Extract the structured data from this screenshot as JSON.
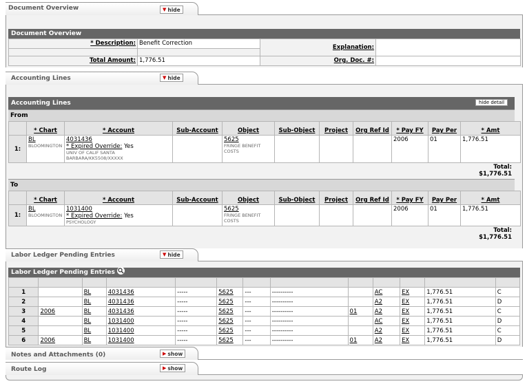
{
  "tabs": {
    "document_overview": {
      "title": "Document Overview",
      "button": "hide"
    },
    "accounting_lines": {
      "title": "Accounting Lines",
      "button": "hide"
    },
    "labor_ledger": {
      "title": "Labor Ledger Pending Entries",
      "button": "hide"
    },
    "notes": {
      "title": "Notes and Attachments (0)",
      "button": "show"
    },
    "route_log": {
      "title": "Route Log",
      "button": "show"
    }
  },
  "document_overview": {
    "header": "Document Overview",
    "description_label": "* Description:",
    "description_value": "Benefit Correction",
    "explanation_label": "Explanation:",
    "explanation_value": "",
    "total_amount_label": "Total Amount:",
    "total_amount_value": "1,776.51",
    "org_doc_label": "Org. Doc. #:",
    "org_doc_value": ""
  },
  "accounting": {
    "header": "Accounting Lines",
    "hide_detail": "hide detail",
    "columns": [
      "* Chart",
      "* Account",
      "Sub-Account",
      "Object",
      "Sub-Object",
      "Project",
      "Org Ref Id",
      "* Pay FY",
      "Pay Per",
      "* Amt"
    ],
    "from": {
      "label": "From",
      "row_num": "1:",
      "chart": "BL",
      "chart_desc": "BLOOMINGTON",
      "account": "4031436",
      "expired": "* Expired Override:",
      "expired_value": "Yes",
      "account_desc": "UNIV OF CALIF SANTA BARBARA/KK5508/XXXXX",
      "object": "5625",
      "object_desc": "FRINGE BENEFIT COSTS",
      "pay_fy": "2006",
      "pay_per": "01",
      "amt": "1,776.51",
      "total_label": "Total:",
      "total_value": "$1,776.51"
    },
    "to": {
      "label": "To",
      "row_num": "1:",
      "chart": "BL",
      "chart_desc": "BLOOMINGTON",
      "account": "1031400",
      "expired": "* Expired Override:",
      "expired_value": "Yes",
      "account_desc": "PSYCHOLOGY",
      "object": "5625",
      "object_desc": "FRINGE BENEFIT COSTS",
      "pay_fy": "2006",
      "pay_per": "01",
      "amt": "1,776.51",
      "total_label": "Total:",
      "total_value": "$1,776.51"
    }
  },
  "labor": {
    "header": "Labor Ledger Pending Entries",
    "rows": [
      {
        "n": "1",
        "fy": "",
        "chart": "BL",
        "acct": "4031436",
        "sub": "-----",
        "obj": "5625",
        "subobj": "---",
        "proj": "----------",
        "ref": "",
        "bal": "AC",
        "type": "EX",
        "amt": "1,776.51",
        "dc": "C"
      },
      {
        "n": "2",
        "fy": "",
        "chart": "BL",
        "acct": "4031436",
        "sub": "-----",
        "obj": "5625",
        "subobj": "---",
        "proj": "----------",
        "ref": "",
        "bal": "A2",
        "type": "EX",
        "amt": "1,776.51",
        "dc": "D"
      },
      {
        "n": "3",
        "fy": "2006",
        "chart": "BL",
        "acct": "4031436",
        "sub": "-----",
        "obj": "5625",
        "subobj": "---",
        "proj": "----------",
        "ref": "01",
        "bal": "A2",
        "type": "EX",
        "amt": "1,776.51",
        "dc": "C"
      },
      {
        "n": "4",
        "fy": "",
        "chart": "BL",
        "acct": "1031400",
        "sub": "-----",
        "obj": "5625",
        "subobj": "---",
        "proj": "----------",
        "ref": "",
        "bal": "AC",
        "type": "EX",
        "amt": "1,776.51",
        "dc": "D"
      },
      {
        "n": "5",
        "fy": "",
        "chart": "BL",
        "acct": "1031400",
        "sub": "-----",
        "obj": "5625",
        "subobj": "---",
        "proj": "----------",
        "ref": "",
        "bal": "A2",
        "type": "EX",
        "amt": "1,776.51",
        "dc": "C"
      },
      {
        "n": "6",
        "fy": "2006",
        "chart": "BL",
        "acct": "1031400",
        "sub": "-----",
        "obj": "5625",
        "subobj": "---",
        "proj": "----------",
        "ref": "01",
        "bal": "A2",
        "type": "EX",
        "amt": "1,776.51",
        "dc": "D"
      }
    ]
  }
}
